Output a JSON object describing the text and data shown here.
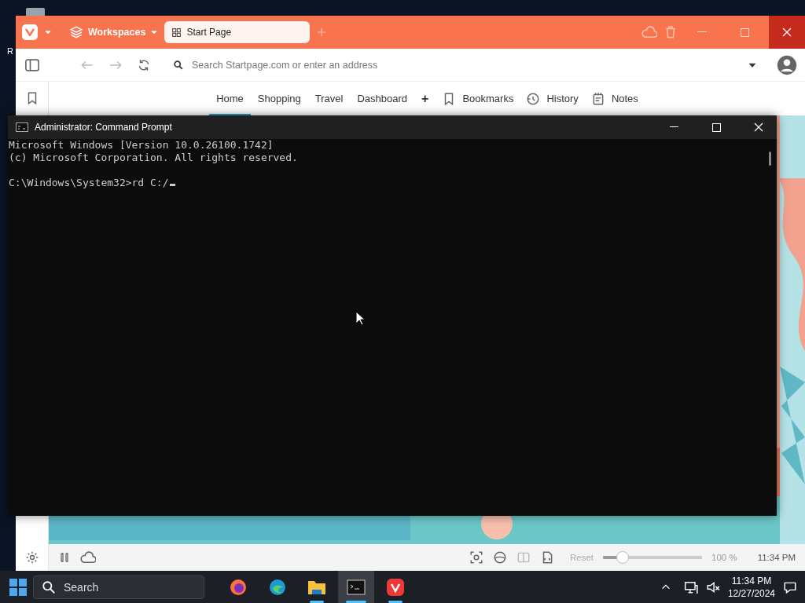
{
  "desktop": {
    "icon_labels": [
      "R"
    ]
  },
  "browser": {
    "workspaces": "Workspaces",
    "tabs": [
      {
        "label": "Start Page",
        "selected": true
      }
    ],
    "address": {
      "placeholder": "Search Startpage.com or enter an address"
    },
    "speed_dials": [
      {
        "label": "Home",
        "selected": true
      },
      {
        "label": "Shopping",
        "selected": false
      },
      {
        "label": "Travel",
        "selected": false
      },
      {
        "label": "Dashboard",
        "selected": false
      }
    ],
    "add_button": "+",
    "panels": [
      {
        "kind": "bookmarks",
        "label": "Bookmarks"
      },
      {
        "kind": "history",
        "label": "History"
      },
      {
        "kind": "notes",
        "label": "Notes"
      }
    ],
    "status_bar": {
      "reset": "Reset",
      "zoom": {
        "level": 0.2
      },
      "zoom_reading": "100 %",
      "clock": "11:34 PM"
    }
  },
  "terminal": {
    "title": "Administrator: Command Prompt",
    "output": [
      "Microsoft Windows [Version 10.0.26100.1742]",
      "(c) Microsoft Corporation. All rights reserved."
    ],
    "prompt": "C:\\Windows\\System32>rd C:/"
  },
  "taskbar": {
    "search": "Search",
    "apps": [
      {
        "kind": "firefox",
        "selected": false,
        "running": false
      },
      {
        "kind": "edge",
        "selected": false,
        "running": false
      },
      {
        "kind": "explorer",
        "selected": false,
        "running": true
      },
      {
        "kind": "terminal",
        "selected": true,
        "running": true
      },
      {
        "kind": "vivaldi",
        "selected": false,
        "running": true
      }
    ],
    "time": "11:34 PM",
    "date": "12/27/2024"
  }
}
